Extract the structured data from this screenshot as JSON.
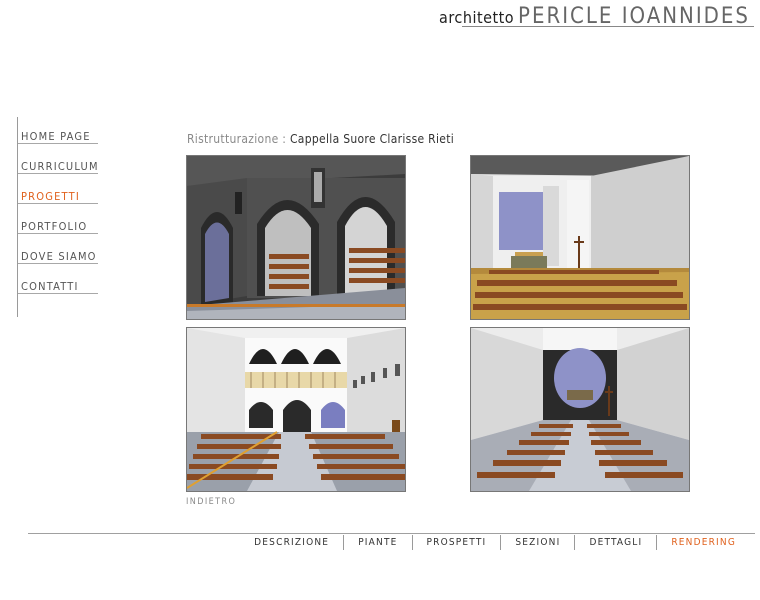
{
  "header": {
    "prefix": "architetto",
    "name": "PERICLE IOANNIDES"
  },
  "nav": {
    "items": [
      {
        "label": "HOME PAGE",
        "active": false
      },
      {
        "label": "CURRICULUM",
        "active": false
      },
      {
        "label": "PROGETTI",
        "active": true
      },
      {
        "label": "PORTFOLIO",
        "active": false
      },
      {
        "label": "DOVE SIAMO",
        "active": false
      },
      {
        "label": "CONTATTI",
        "active": false
      }
    ]
  },
  "project": {
    "category": "Ristrutturazione",
    "separator": " : ",
    "name": "Cappella Suore Clarisse Rieti"
  },
  "back_label": "INDIETRO",
  "bottom_nav": {
    "items": [
      {
        "label": "DESCRIZIONE",
        "active": false
      },
      {
        "label": "PIANTE",
        "active": false
      },
      {
        "label": "PROSPETTI",
        "active": false
      },
      {
        "label": "SEZIONI",
        "active": false
      },
      {
        "label": "DETTAGLI",
        "active": false
      },
      {
        "label": "RENDERING",
        "active": true
      }
    ]
  },
  "colors": {
    "accent": "#e0611d",
    "text": "#555555",
    "rule": "#a0a0a0"
  }
}
